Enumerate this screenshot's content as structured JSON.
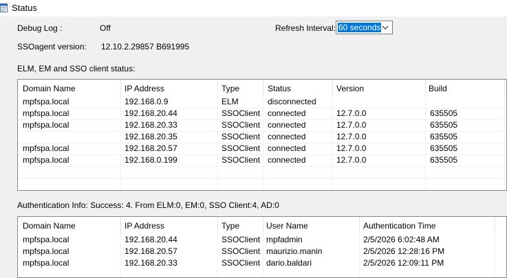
{
  "window": {
    "title": "Status"
  },
  "debug_log": {
    "label": "Debug Log :",
    "value": "Off"
  },
  "sso_agent": {
    "label": "SSOagent version:",
    "value": "12.10.2.29857 B691995"
  },
  "refresh": {
    "label": "Refresh Interval:",
    "selected": "60 seconds"
  },
  "client_status": {
    "label": "ELM, EM and SSO client status:",
    "columns": [
      "Domain Name",
      "IP Address",
      "Type",
      "Status",
      "Version",
      "Build"
    ],
    "rows": [
      [
        "mpfspa.local",
        "192.168.0.9",
        "ELM",
        "disconnected",
        "",
        ""
      ],
      [
        "mpfspa.local",
        "192.168.20.44",
        "SSOClient",
        "connected",
        "12.7.0.0",
        "635505"
      ],
      [
        "mpfspa.local",
        "192.168.20.33",
        "SSOClient",
        "connected",
        "12.7.0.0",
        "635505"
      ],
      [
        "",
        "192.168.20.35",
        "SSOClient",
        "connected",
        "12.7.0.0",
        "635505"
      ],
      [
        "mpfspa.local",
        "192.168.20.57",
        "SSOClient",
        "connected",
        "12.7.0.0",
        "635505"
      ],
      [
        "mpfspa.local",
        "192.168.0.199",
        "SSOClient",
        "connected",
        "12.7.0.0",
        "635505"
      ]
    ]
  },
  "auth_info": {
    "label": "Authentication Info: Success: 4. From ELM:0, EM:0, SSO Client:4, AD:0",
    "columns": [
      "Domain Name",
      "IP Address",
      "Type",
      "User Name",
      "Authentication Time"
    ],
    "rows": [
      [
        "mpfspa.local",
        "192.168.20.44",
        "SSOClient",
        "mpfadmin",
        "2/5/2026 6:02:48 AM"
      ],
      [
        "mpfspa.local",
        "192.168.20.57",
        "SSOClient",
        "maurizio.manin",
        "2/5/2026 12:28:16 PM"
      ],
      [
        "mpfspa.local",
        "192.168.20.33",
        "SSOClient",
        "dario.baldari",
        "2/5/2026 12:09:11 PM"
      ]
    ]
  }
}
